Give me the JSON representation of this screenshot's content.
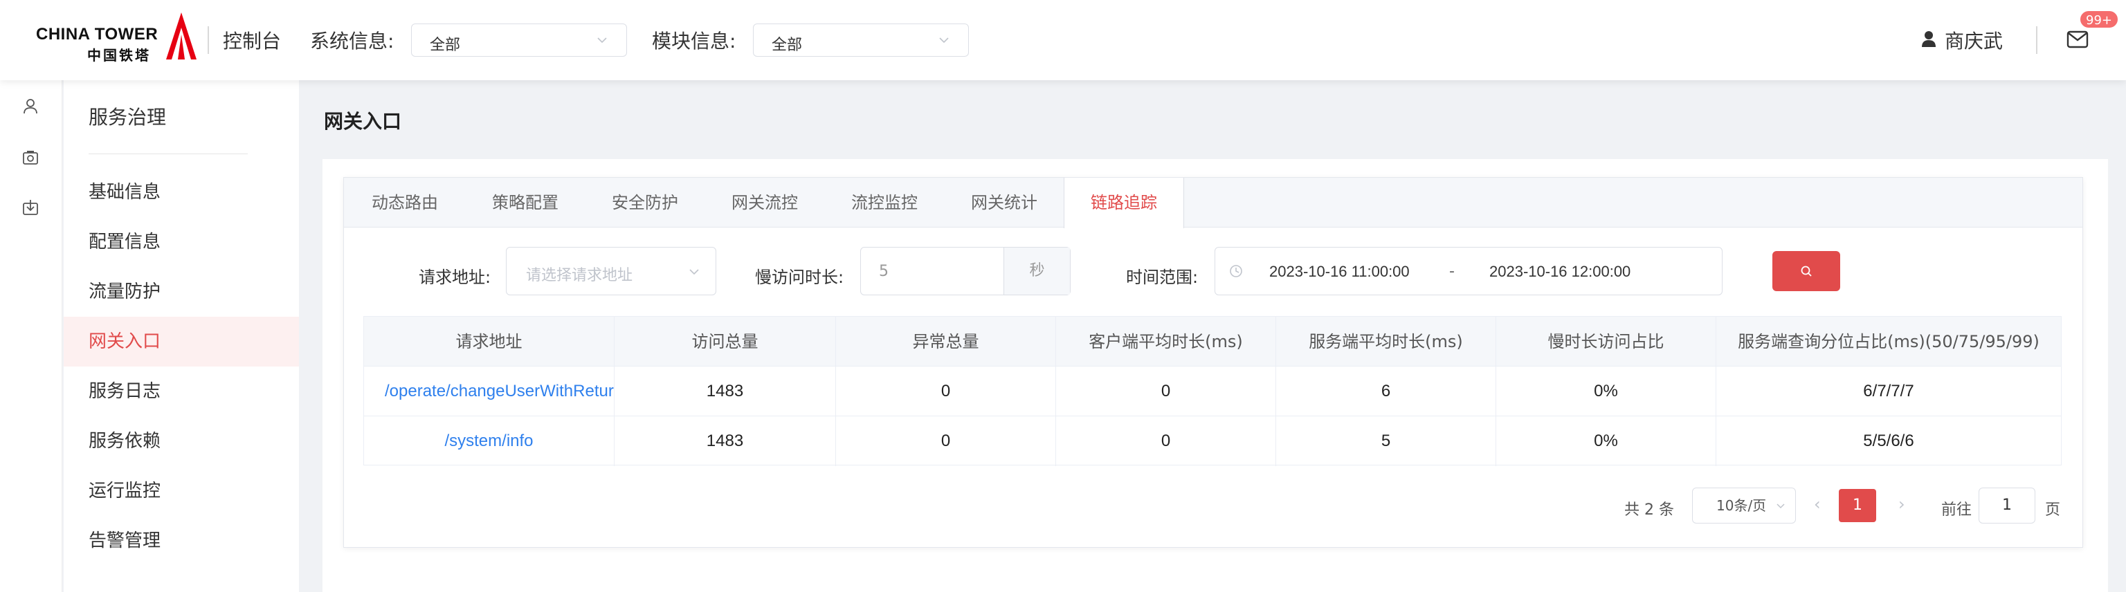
{
  "header": {
    "logo_en": "CHINA TOWER",
    "logo_cn": "中国铁塔",
    "console": "控制台",
    "system_info_label": "系统信息:",
    "system_info_value": "全部",
    "module_info_label": "模块信息:",
    "module_info_value": "全部",
    "user_name": "商庆武",
    "mail_badge": "99+"
  },
  "sidebar": {
    "title": "服务治理",
    "items": [
      {
        "label": "基础信息"
      },
      {
        "label": "配置信息"
      },
      {
        "label": "流量防护"
      },
      {
        "label": "网关入口",
        "active": true
      },
      {
        "label": "服务日志"
      },
      {
        "label": "服务依赖"
      },
      {
        "label": "运行监控"
      },
      {
        "label": "告警管理"
      }
    ]
  },
  "page": {
    "title": "网关入口"
  },
  "tabs": [
    {
      "label": "动态路由"
    },
    {
      "label": "策略配置"
    },
    {
      "label": "安全防护"
    },
    {
      "label": "网关流控"
    },
    {
      "label": "流控监控"
    },
    {
      "label": "网关统计"
    },
    {
      "label": "链路追踪",
      "active": true
    }
  ],
  "filters": {
    "request_addr_label": "请求地址:",
    "request_addr_placeholder": "请选择请求地址",
    "slow_label": "慢访问时长:",
    "slow_value": "5",
    "slow_unit": "秒",
    "time_range_label": "时间范围:",
    "time_start": "2023-10-16 11:00:00",
    "time_sep": "-",
    "time_end": "2023-10-16 12:00:00"
  },
  "table": {
    "columns": [
      "请求地址",
      "访问总量",
      "异常总量",
      "客户端平均时长(ms)",
      "服务端平均时长(ms)",
      "慢时长访问占比",
      "服务端查询分位占比(ms)(50/75/95/99)"
    ],
    "rows": [
      [
        "/operate/changeUserWithReturn",
        "1483",
        "0",
        "0",
        "6",
        "0%",
        "6/7/7/7"
      ],
      [
        "/system/info",
        "1483",
        "0",
        "0",
        "5",
        "0%",
        "5/5/6/6"
      ]
    ]
  },
  "pagination": {
    "total": "共 2 条",
    "page_size": "10条/页",
    "current": "1",
    "goto_label": "前往",
    "goto_value": "1",
    "page_unit": "页"
  },
  "colors": {
    "accent": "#e14b4b",
    "link": "#2f80ed"
  }
}
